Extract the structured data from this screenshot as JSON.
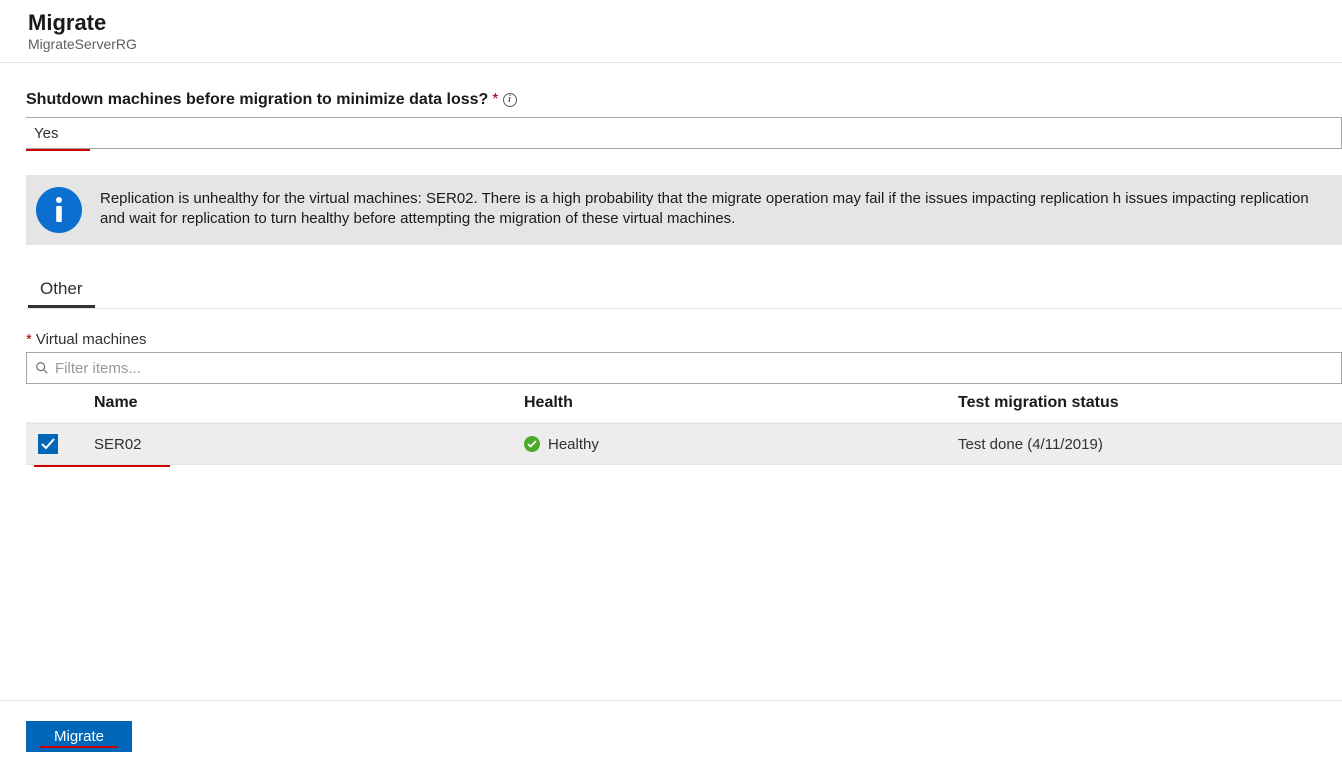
{
  "header": {
    "title": "Migrate",
    "subtitle": "MigrateServerRG"
  },
  "shutdown_field": {
    "label": "Shutdown machines before migration to minimize data loss?",
    "required_marker": "*",
    "value": "Yes"
  },
  "info_banner": {
    "text": "Replication is unhealthy for the virtual machines: SER02. There is a high probability that the migrate operation may fail if the issues impacting replication h issues impacting replication and wait for replication to turn healthy before attempting the migration of these virtual machines."
  },
  "tabs": [
    {
      "label": "Other",
      "active": true
    }
  ],
  "vm_section": {
    "label": "Virtual machines",
    "required_marker": "*",
    "filter_placeholder": "Filter items..."
  },
  "table": {
    "columns": {
      "name": "Name",
      "health": "Health",
      "status": "Test migration status"
    },
    "rows": [
      {
        "checked": true,
        "name": "SER02",
        "health": "Healthy",
        "status": "Test done (4/11/2019)"
      }
    ]
  },
  "footer": {
    "migrate_label": "Migrate"
  }
}
